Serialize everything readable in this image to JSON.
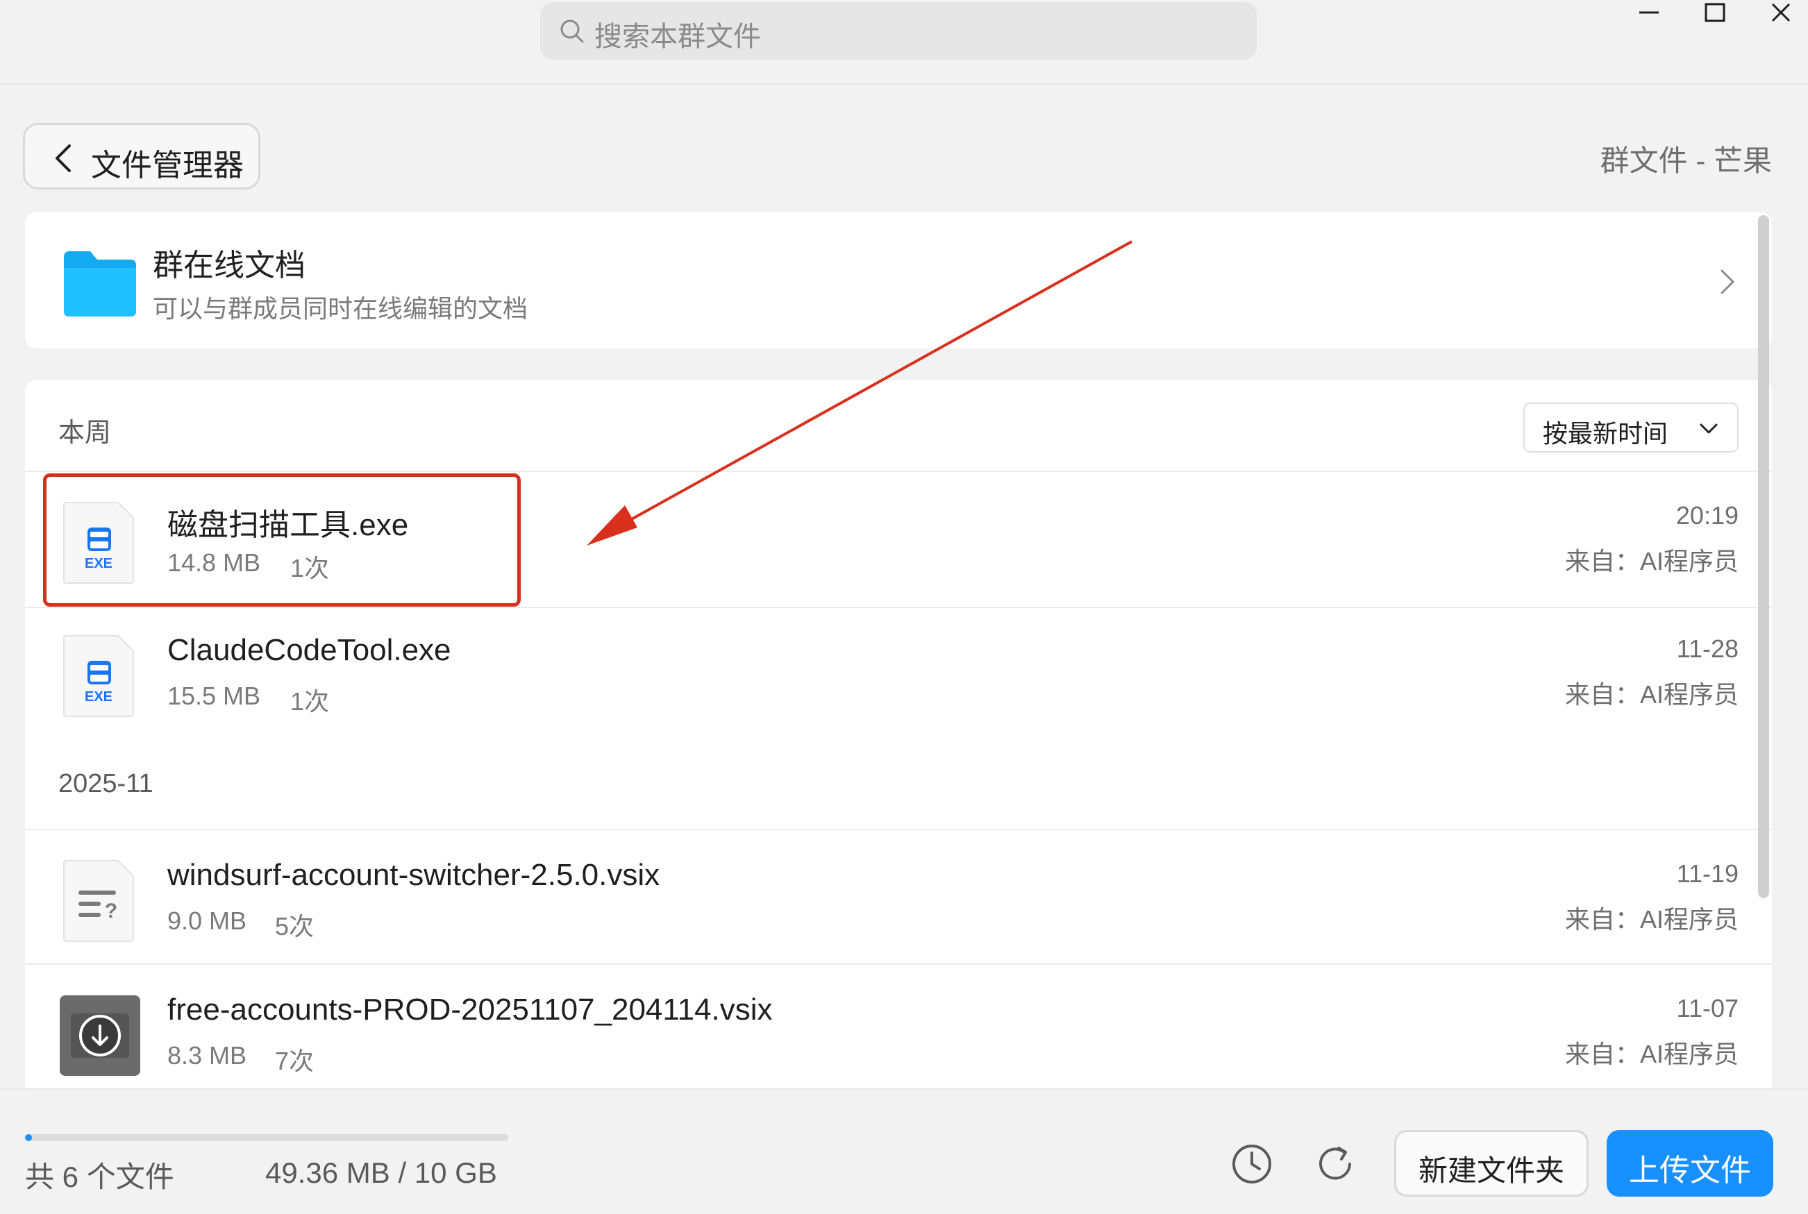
{
  "titlebar": {
    "search_placeholder": "搜索本群文件"
  },
  "header": {
    "back_label": "文件管理器",
    "group_title": "群文件 - 芒果"
  },
  "online_docs": {
    "title": "群在线文档",
    "subtitle": "可以与群成员同时在线编辑的文档"
  },
  "sort": {
    "label": "按最新时间"
  },
  "sections": [
    {
      "label": "本周",
      "files": [
        {
          "name": "磁盘扫描工具.exe",
          "size": "14.8 MB",
          "count": "1次",
          "time": "20:19",
          "source": "来自：AI程序员",
          "icon": "exe-file-icon"
        },
        {
          "name": "ClaudeCodeTool.exe",
          "size": "15.5 MB",
          "count": "1次",
          "time": "11-28",
          "source": "来自：AI程序员",
          "icon": "exe-file-icon"
        }
      ]
    },
    {
      "label": "2025-11",
      "files": [
        {
          "name": "windsurf-account-switcher-2.5.0.vsix",
          "size": "9.0 MB",
          "count": "5次",
          "time": "11-19",
          "source": "来自：AI程序员",
          "icon": "unknown-file-icon"
        },
        {
          "name": "free-accounts-PROD-20251107_204114.vsix",
          "size": "8.3 MB",
          "count": "7次",
          "time": "11-07",
          "source": "来自：AI程序员",
          "icon": "download-file-icon"
        }
      ]
    }
  ],
  "footer": {
    "file_count": "共 6 个文件",
    "storage": "49.36 MB / 10 GB",
    "usage_fraction": 0.005,
    "new_folder_label": "新建文件夹",
    "upload_label": "上传文件"
  },
  "colors": {
    "accent": "#1890ff",
    "annotation": "#d9301d",
    "folder": "#13aaf0"
  }
}
